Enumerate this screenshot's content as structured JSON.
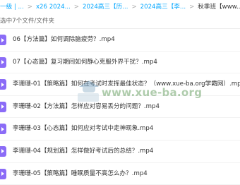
{
  "breadcrumb": {
    "items": [
      "一级 | ...",
      "x26 2024...",
      "2024高三【历...",
      "2024高三【李...",
      "秋季班【www...."
    ]
  },
  "selection": {
    "text": "选中7个文件/文件夹"
  },
  "files": [
    {
      "name": "06【方法篇】如何调除脑疲劳？.mp4"
    },
    {
      "name": "07【心态篇】复习期间如何静心克服外界干扰？.mp4"
    },
    {
      "name": "李珊珊-01【策略篇】如何在考试时发挥最佳状态？（www.xue-ba.org学霸网）.mp4"
    },
    {
      "name": "李珊珊-02【方法篇】怎样应对容易丢分的问题？.mp4"
    },
    {
      "name": "李珊珊-03【心态篇】如何应对考试中走神现象.mp4"
    },
    {
      "name": "李珊珊-04【规划篇】怎样做好考试后的总结？.mp4"
    },
    {
      "name": "李珊珊-05【策略篇】睡眠质量不高怎么办？.mp4"
    }
  ],
  "watermark": {
    "text": "www.xue-ba.org"
  },
  "colors": {
    "link": "#06a7ff",
    "video_icon": "#8b6cf7",
    "watermark_text": "#6fa36a"
  },
  "icons": {
    "file": "video-file-icon",
    "watermark": "graduation-cap-icon"
  }
}
